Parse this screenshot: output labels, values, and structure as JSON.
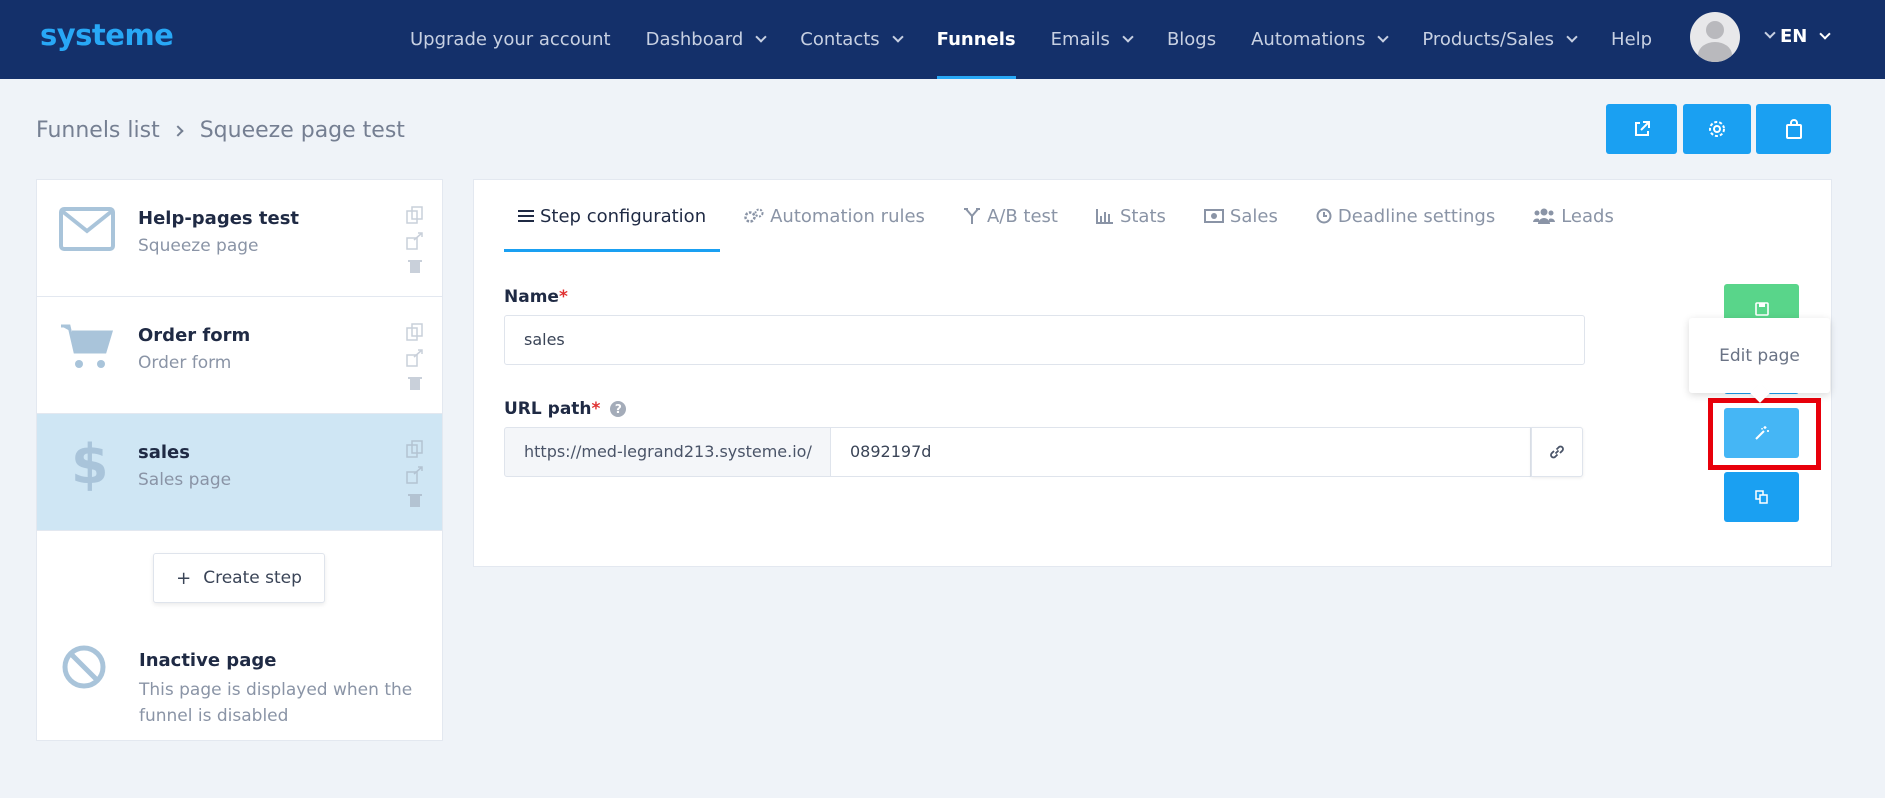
{
  "app": {
    "logo": "systeme"
  },
  "nav": {
    "items": [
      {
        "label": "Upgrade your account"
      },
      {
        "label": "Dashboard"
      },
      {
        "label": "Contacts"
      },
      {
        "label": "Funnels"
      },
      {
        "label": "Emails"
      },
      {
        "label": "Blogs"
      },
      {
        "label": "Automations"
      },
      {
        "label": "Products/Sales"
      },
      {
        "label": "Help"
      }
    ],
    "language": "EN"
  },
  "breadcrumb": {
    "parent": "Funnels list",
    "current": "Squeeze page test"
  },
  "steps": [
    {
      "title": "Help-pages test",
      "type": "Squeeze page",
      "icon": "envelope-icon"
    },
    {
      "title": "Order form",
      "type": "Order form",
      "icon": "cart-icon"
    },
    {
      "title": "sales",
      "type": "Sales page",
      "icon": "dollar-icon"
    }
  ],
  "create_step": {
    "label": "Create step"
  },
  "inactive": {
    "title": "Inactive page",
    "description": "This page is displayed when the funnel is disabled"
  },
  "tabs": [
    {
      "label": "Step configuration",
      "icon": "list-icon"
    },
    {
      "label": "Automation rules",
      "icon": "gears-icon"
    },
    {
      "label": "A/B test",
      "icon": "split-icon"
    },
    {
      "label": "Stats",
      "icon": "bar-chart-icon"
    },
    {
      "label": "Sales",
      "icon": "money-icon"
    },
    {
      "label": "Deadline settings",
      "icon": "clock-icon"
    },
    {
      "label": "Leads",
      "icon": "users-icon"
    }
  ],
  "form": {
    "name_label": "Name",
    "name_value": "sales",
    "url_label": "URL path",
    "url_prefix": "https://med-legrand213.systeme.io/",
    "url_value": "0892197d",
    "required_mark": "*"
  },
  "tooltip": {
    "label": "Edit page"
  },
  "colors": {
    "navbar": "#14306a",
    "accent": "#1aa0f2",
    "save": "#59d58a",
    "highlight": "#e8000b"
  }
}
